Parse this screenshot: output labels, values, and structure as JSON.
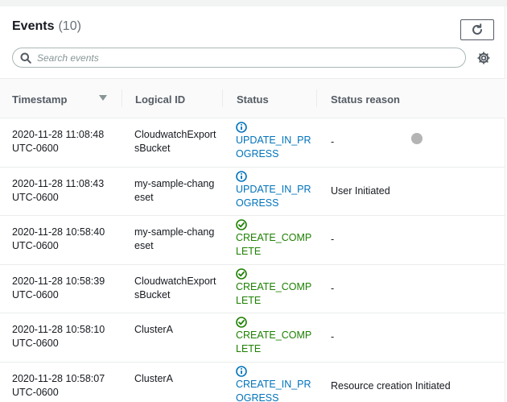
{
  "panel": {
    "title": "Events",
    "count": "(10)"
  },
  "search": {
    "placeholder": "Search events",
    "value": ""
  },
  "columns": {
    "timestamp": "Timestamp",
    "logical_id": "Logical ID",
    "status": "Status",
    "status_reason": "Status reason"
  },
  "rows": [
    {
      "timestamp": "2020-11-28 11:08:48 UTC-0600",
      "logical_id": "CloudwatchExportsBucket",
      "status": "UPDATE_IN_PROGRESS",
      "status_kind": "info",
      "reason": "-"
    },
    {
      "timestamp": "2020-11-28 11:08:43 UTC-0600",
      "logical_id": "my-sample-changeset",
      "status": "UPDATE_IN_PROGRESS",
      "status_kind": "info",
      "reason": "User Initiated"
    },
    {
      "timestamp": "2020-11-28 10:58:40 UTC-0600",
      "logical_id": "my-sample-changeset",
      "status": "CREATE_COMPLETE",
      "status_kind": "success",
      "reason": "-"
    },
    {
      "timestamp": "2020-11-28 10:58:39 UTC-0600",
      "logical_id": "CloudwatchExportsBucket",
      "status": "CREATE_COMPLETE",
      "status_kind": "success",
      "reason": "-"
    },
    {
      "timestamp": "2020-11-28 10:58:10 UTC-0600",
      "logical_id": "ClusterA",
      "status": "CREATE_COMPLETE",
      "status_kind": "success",
      "reason": "-"
    },
    {
      "timestamp": "2020-11-28 10:58:07 UTC-0600",
      "logical_id": "ClusterA",
      "status": "CREATE_IN_PROGRESS",
      "status_kind": "info",
      "reason": "Resource creation Initiated"
    }
  ],
  "icons": {
    "refresh": "refresh-icon",
    "search": "search-icon",
    "settings": "gear-icon",
    "sort": "sort-descending-icon",
    "status_info": "info-circle-icon",
    "status_success": "check-circle-icon"
  },
  "colors": {
    "info": "#0073bb",
    "success": "#1d8102",
    "text": "#16191f",
    "muted": "#687078"
  }
}
